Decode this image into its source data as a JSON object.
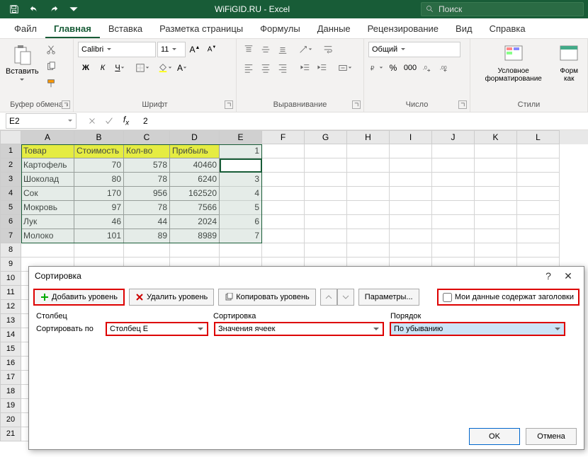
{
  "title": "WiFiGID.RU - Excel",
  "search_placeholder": "Поиск",
  "menu": [
    "Файл",
    "Главная",
    "Вставка",
    "Разметка страницы",
    "Формулы",
    "Данные",
    "Рецензирование",
    "Вид",
    "Справка"
  ],
  "menu_active": 1,
  "ribbon": {
    "clipboard": {
      "label": "Буфер обмена",
      "paste": "Вставить"
    },
    "font": {
      "label": "Шрифт",
      "name": "Calibri",
      "size": "11"
    },
    "align": {
      "label": "Выравнивание"
    },
    "number": {
      "label": "Число",
      "format": "Общий"
    },
    "styles": {
      "label": "Стили",
      "cond": "Условное форматирование",
      "fmt": "Форм как"
    }
  },
  "namebox": "E2",
  "formula": "2",
  "columns": [
    "A",
    "B",
    "C",
    "D",
    "E",
    "F",
    "G",
    "H",
    "I",
    "J",
    "K",
    "L"
  ],
  "header_row": [
    "Товар",
    "Стоимость",
    "Кол-во",
    "Прибыль"
  ],
  "data_rows": [
    [
      "Картофель",
      "70",
      "578",
      "40460"
    ],
    [
      "Шоколад",
      "80",
      "78",
      "6240"
    ],
    [
      "Сок",
      "170",
      "956",
      "162520"
    ],
    [
      "Мокровь",
      "97",
      "78",
      "7566"
    ],
    [
      "Лук",
      "46",
      "44",
      "2024"
    ],
    [
      "Молоко",
      "101",
      "89",
      "8989"
    ]
  ],
  "e_col": [
    "1",
    "2",
    "3",
    "4",
    "5",
    "6",
    "7"
  ],
  "dialog": {
    "title": "Сортировка",
    "add_level": "Добавить уровень",
    "del_level": "Удалить уровень",
    "copy_level": "Копировать уровень",
    "params": "Параметры...",
    "headers_check": "Мои данные содержат заголовки",
    "col_header": "Столбец",
    "sort_header": "Сортировка",
    "order_header": "Порядок",
    "sort_by": "Сортировать по",
    "col_val": "Столбец E",
    "sort_val": "Значения ячеек",
    "order_val": "По убыванию",
    "ok": "OK",
    "cancel": "Отмена"
  },
  "chart_data": {
    "type": "table",
    "headers": [
      "Товар",
      "Стоимость",
      "Кол-во",
      "Прибыль"
    ],
    "rows": [
      [
        "Картофель",
        70,
        578,
        40460
      ],
      [
        "Шоколад",
        80,
        78,
        6240
      ],
      [
        "Сок",
        170,
        956,
        162520
      ],
      [
        "Мокровь",
        97,
        78,
        7566
      ],
      [
        "Лук",
        46,
        44,
        2024
      ],
      [
        "Молоко",
        101,
        89,
        8989
      ]
    ]
  }
}
